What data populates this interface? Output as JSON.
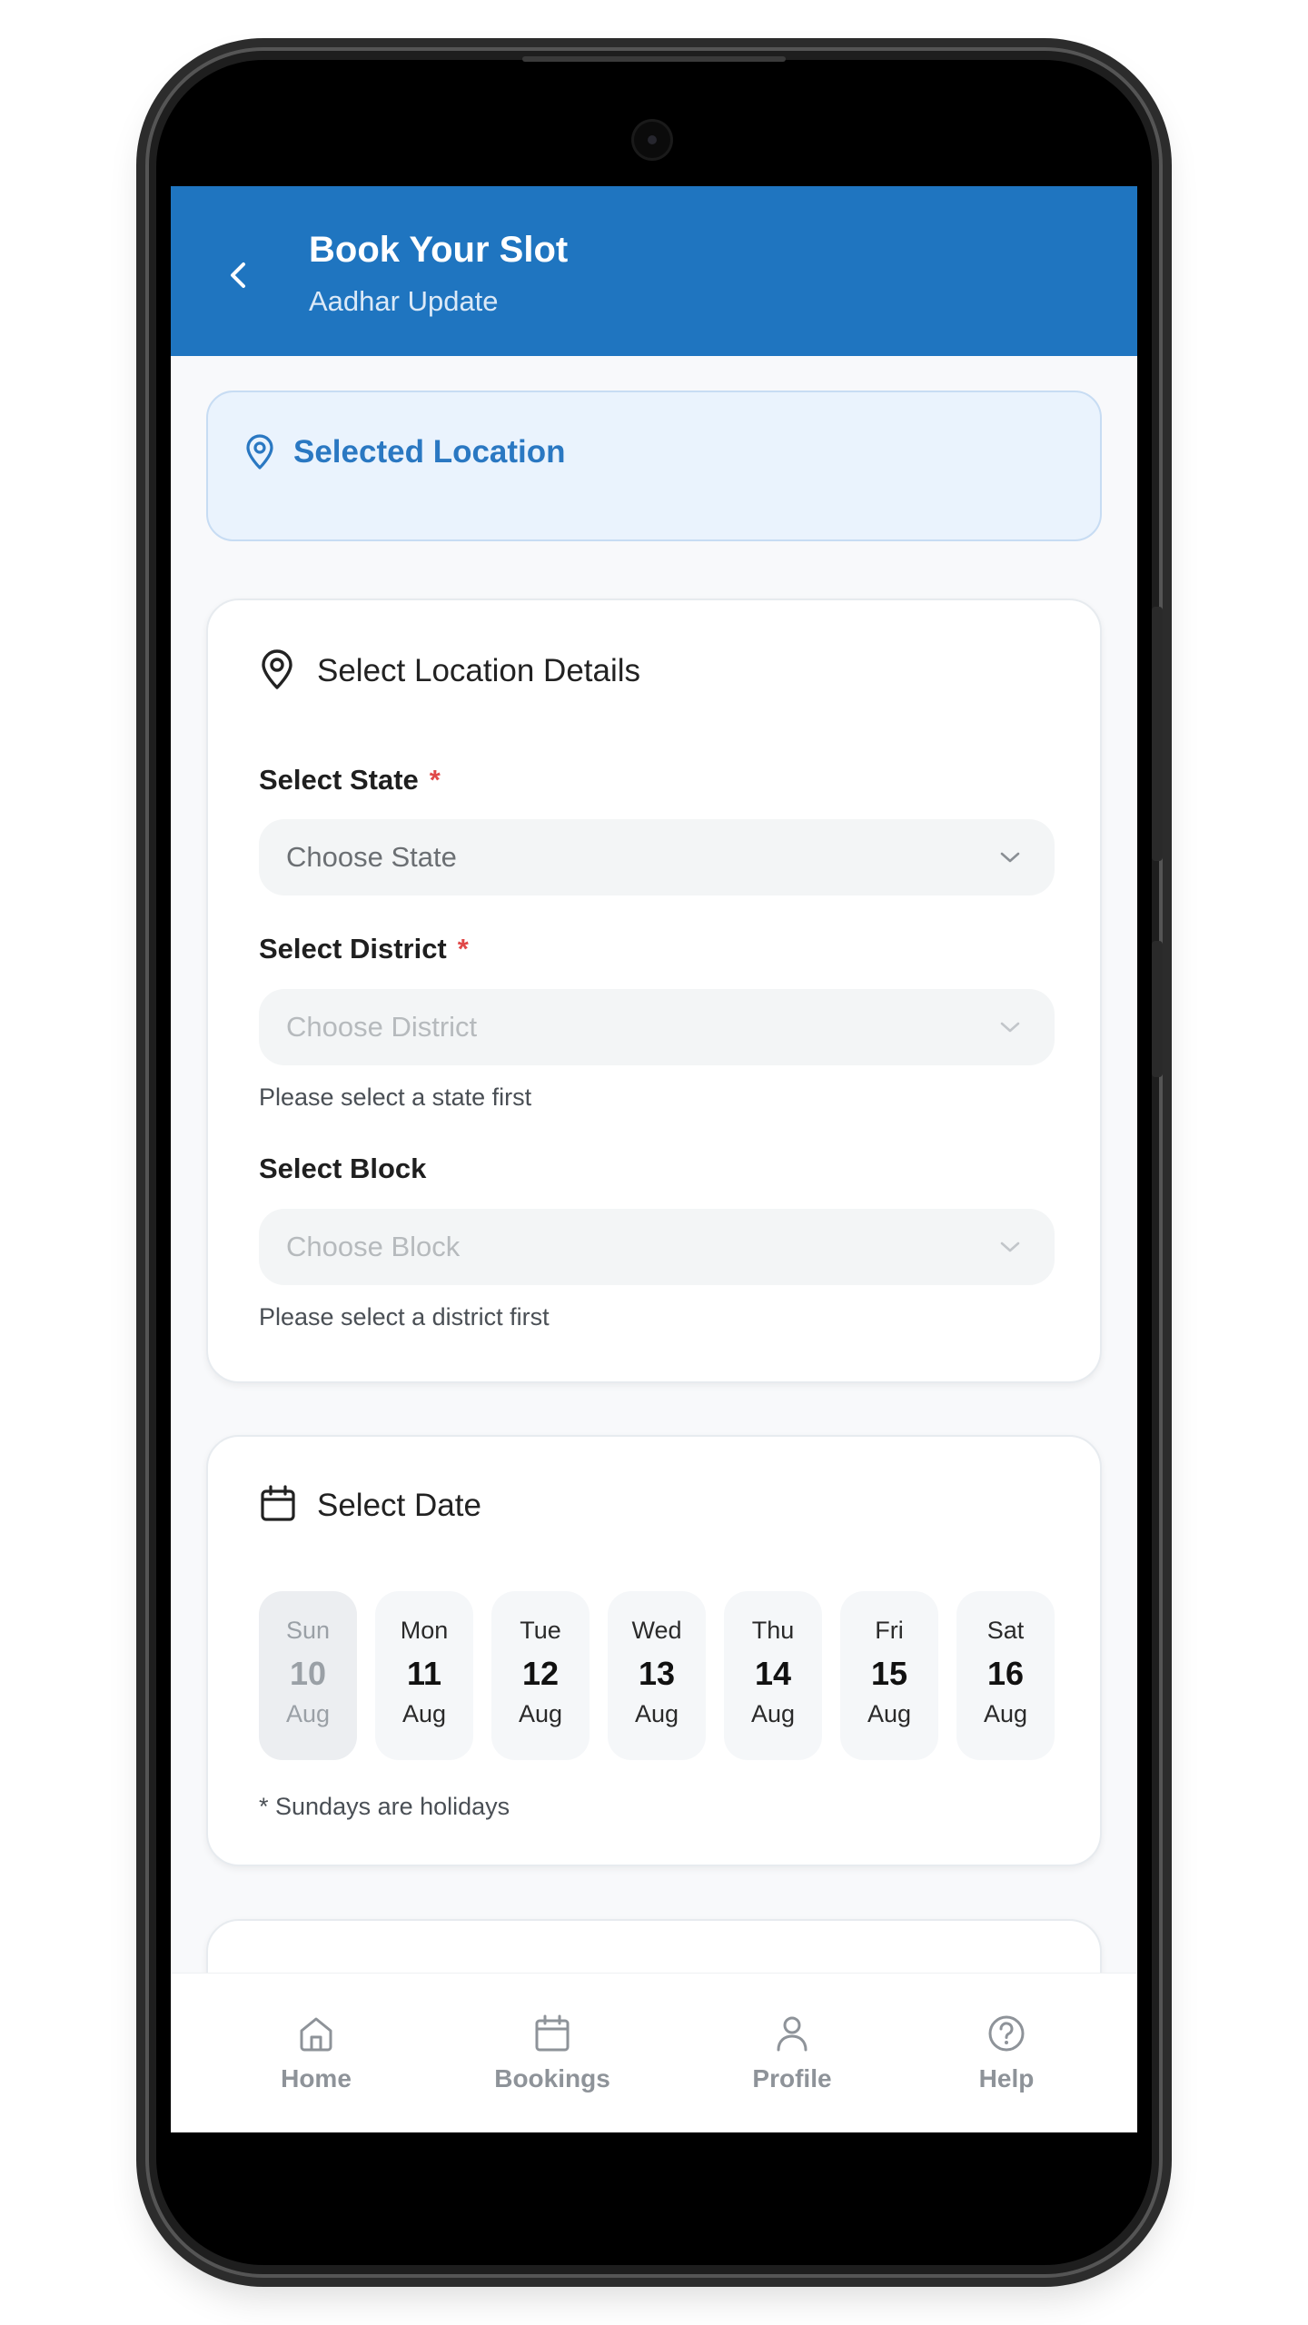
{
  "header": {
    "title": "Book Your Slot",
    "subtitle": "Aadhar Update"
  },
  "selected_location": {
    "label": "Selected Location"
  },
  "location_details": {
    "title": "Select Location Details",
    "state": {
      "label": "Select State",
      "required_mark": "*",
      "placeholder": "Choose State"
    },
    "district": {
      "label": "Select District",
      "required_mark": "*",
      "placeholder": "Choose District",
      "hint": "Please select a state first"
    },
    "block": {
      "label": "Select Block",
      "placeholder": "Choose Block",
      "hint": "Please select a district first"
    }
  },
  "date_picker": {
    "title": "Select Date",
    "days": [
      {
        "weekday": "Sun",
        "date": "10",
        "month": "Aug",
        "holiday": true
      },
      {
        "weekday": "Mon",
        "date": "11",
        "month": "Aug"
      },
      {
        "weekday": "Tue",
        "date": "12",
        "month": "Aug"
      },
      {
        "weekday": "Wed",
        "date": "13",
        "month": "Aug"
      },
      {
        "weekday": "Thu",
        "date": "14",
        "month": "Aug"
      },
      {
        "weekday": "Fri",
        "date": "15",
        "month": "Aug"
      },
      {
        "weekday": "Sat",
        "date": "16",
        "month": "Aug"
      }
    ],
    "note": "* Sundays are holidays"
  },
  "bottom_nav": {
    "items": [
      {
        "label": "Home",
        "icon": "home-icon"
      },
      {
        "label": "Bookings",
        "icon": "calendar-icon"
      },
      {
        "label": "Profile",
        "icon": "user-icon"
      },
      {
        "label": "Help",
        "icon": "help-icon"
      }
    ]
  },
  "colors": {
    "header": "#1f75c0",
    "accent_text": "#2a78c2",
    "required": "#e04848"
  }
}
